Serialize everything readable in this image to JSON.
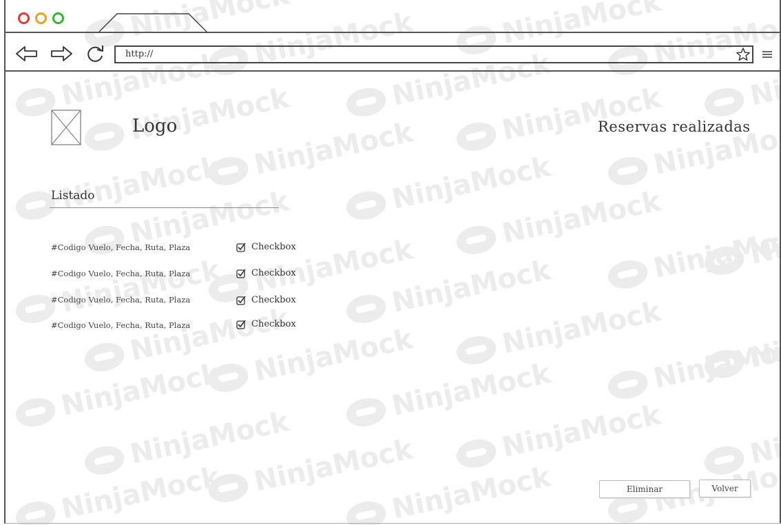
{
  "browser": {
    "address_value": "http://",
    "colors": {
      "close": "#e23b2e",
      "minimize": "#e8a317",
      "maximize": "#2eb82e",
      "stroke": "#444444"
    },
    "icons": [
      "back-arrow-icon",
      "forward-arrow-icon",
      "reload-icon",
      "star-icon",
      "menu-icon"
    ]
  },
  "header": {
    "logo_text": "Logo",
    "title": "Reservas realizadas"
  },
  "listado": {
    "title": "Listado",
    "rows": [
      {
        "text": "#Codigo Vuelo, Fecha, Ruta, Plaza",
        "checkbox_label": "Checkbox",
        "checked": true
      },
      {
        "text": "#Codigo Vuelo, Fecha, Ruta, Plaza",
        "checkbox_label": "Checkbox",
        "checked": true
      },
      {
        "text": "#Codigo Vuelo, Fecha, Ruta, Plaza",
        "checkbox_label": "Checkbox",
        "checked": true
      },
      {
        "text": "#Codigo Vuelo, Fecha, Ruta, Plaza",
        "checkbox_label": "Checkbox",
        "checked": true
      }
    ]
  },
  "actions": {
    "delete_label": "Eliminar",
    "back_label": "Volver"
  },
  "watermark": {
    "text": "NinjaMock"
  }
}
